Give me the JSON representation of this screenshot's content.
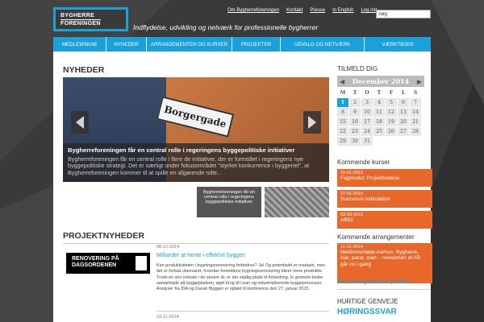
{
  "header": {
    "logo_line1": "BYGHERRE",
    "logo_line2": "FORENINGEN",
    "tagline": "Indflydelse, udvikling og netværk for professionelle bygherrer",
    "top_links": [
      "Om Bygherreforeningen",
      "Kontakt",
      "Presse",
      "In English",
      "Log ind"
    ],
    "search_value": "Søg"
  },
  "nav": {
    "items": [
      "MEDLEMSKAB",
      "NYHEDER",
      "ARRANGEMENTER OG KURSER",
      "PROJEKTER",
      "UDVALG OG NETVÆRK",
      "VÆRKTØJER"
    ]
  },
  "news": {
    "title": "NYHEDER",
    "sign_text": "Borgergade",
    "slide_title": "Bygherreforeningen får en central rolle i regeringens byggepolitiske initiativer",
    "slide_text": "Bygherreforeningen får en central rolle i flere de initiativer, der er forestået i regeringens nye byggepolitiske strategi. Det er særligt under fokusområdet \"styrket konkurrence i byggeriet\", at Bygherreforeningen kommer til at spille en afgørende rolle...",
    "thumbs": [
      "Bygherreforeningen får en central rolle i regeringens byggepolitiske initiativer",
      ""
    ]
  },
  "projects": {
    "title": "PROJEKTNYHEDER",
    "items": [
      {
        "date": "08-12-2014",
        "title": "Milliarder at hente i effektivt byggeri",
        "image_text_1": "RENOVERING PÅ",
        "image_text_2": "DAGSORDENEN",
        "text": "Kan produktiviteten i bygningsrenovering forbedres? Ja! Og potentialet er markant, men det er fortsat ubesvaret, hvordan fremtidens bygningsrenovering bliver mere produktiv. Trods en stor indsats i de senere år, er der stadig plads til forbedring, fx gennem bedre samarbejde på byggepladsen, øget brug af Lean og industrialiserede byggeprocesser. Analyser fra IDA og Dansk Byggeri er optakt til konference den 27. januar 2015."
      },
      {
        "date": "23-11-2014"
      }
    ]
  },
  "sidebar": {
    "subscribe_title": "TILMELD DIG",
    "calendar": {
      "month": "December 2014",
      "prev": "◀",
      "next": "▶",
      "weekdays": [
        "M",
        "T",
        "O",
        "T",
        "F",
        "L",
        "S"
      ],
      "today": 1,
      "days": [
        1,
        2,
        3,
        4,
        5,
        6,
        7,
        8,
        9,
        10,
        11,
        12,
        13,
        14,
        15,
        16,
        17,
        18,
        19,
        20,
        21,
        22,
        23,
        24,
        25,
        26,
        27,
        28,
        29,
        30,
        31
      ]
    },
    "courses_title": "Kommende kurser",
    "courses": [
      {
        "date": "19-01-2015",
        "title": "Fagmodul: Projektledelse"
      },
      {
        "date": "27-01-2015",
        "title": "Successiv kalkulation"
      },
      {
        "date": "03-03-2015",
        "title": "AB92"
      }
    ],
    "events_title": "Kommende arrangementer",
    "events": [
      {
        "date": "11-12-2014",
        "title": "Medlemsmøde Aarhus: Bygherre, klar, parat, start – revisionen af AB går nu i gang"
      }
    ],
    "all_events_link": "Alle arrangementer på liste",
    "quick_title": "HURTIGE GENVEJE",
    "hearings": "HØRINGSSVAR"
  },
  "colors": {
    "accent": "#1aa1dc",
    "orange": "#e8672a",
    "dark_bg": "#3a3a3a"
  }
}
